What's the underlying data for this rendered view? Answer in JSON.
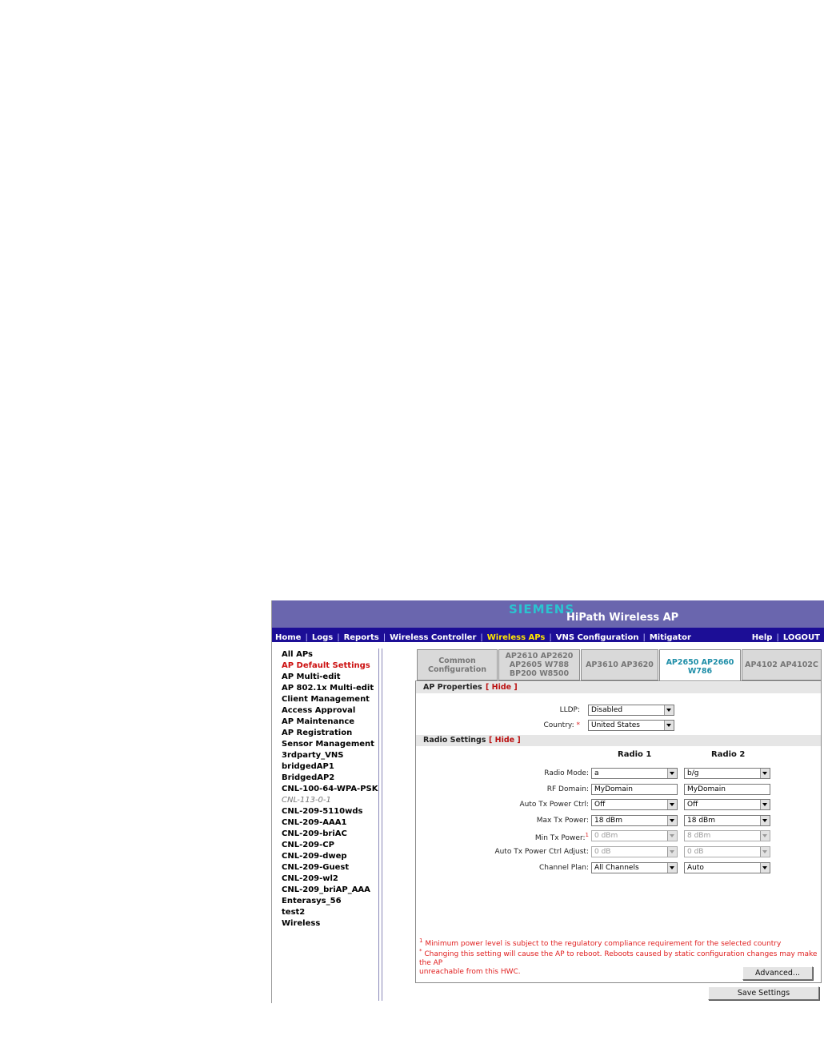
{
  "header": {
    "brand": "SIEMENS",
    "product": "HiPath Wireless AP"
  },
  "nav": {
    "left": [
      "Home",
      "Logs",
      "Reports",
      "Wireless Controller",
      "Wireless APs",
      "VNS Configuration",
      "Mitigator"
    ],
    "active": "Wireless APs",
    "right": [
      "Help",
      "LOGOUT"
    ]
  },
  "sidebar": {
    "items": [
      "All APs",
      "AP Default Settings",
      "AP Multi-edit",
      "AP 802.1x Multi-edit",
      "Client Management",
      "Access Approval",
      "AP Maintenance",
      "AP Registration",
      "Sensor Management",
      "3rdparty_VNS",
      "bridgedAP1",
      "BridgedAP2",
      "CNL-100-64-WPA-PSK",
      "CNL-113-0-1",
      "CNL-209-5110wds",
      "CNL-209-AAA1",
      "CNL-209-briAC",
      "CNL-209-CP",
      "CNL-209-dwep",
      "CNL-209-Guest",
      "CNL-209-wl2",
      "CNL-209_briAP_AAA",
      "Enterasys_56",
      "test2",
      "Wireless"
    ],
    "selected": "AP Default Settings"
  },
  "tabs": [
    {
      "label": "Common\nConfiguration"
    },
    {
      "label": "AP2610 AP2620\nAP2605 W788\nBP200 W8500"
    },
    {
      "label": "AP3610 AP3620"
    },
    {
      "label": "AP2650 AP2660\nW786"
    },
    {
      "label": "AP4102 AP4102C"
    }
  ],
  "active_tab": "AP2650 AP2660 W786",
  "ap_properties": {
    "title": "AP Properties",
    "hide": "[ Hide ]",
    "lldp_label": "LLDP:",
    "lldp_value": "Disabled",
    "country_label": "Country:",
    "country_required": "*",
    "country_value": "United States"
  },
  "radio_settings": {
    "title": "Radio Settings",
    "hide": "[ Hide ]",
    "col1": "Radio 1",
    "col2": "Radio 2",
    "rows": [
      {
        "label": "Radio Mode:",
        "r1": "a",
        "r2": "b/g"
      },
      {
        "label": "RF Domain:",
        "r1": "MyDomain",
        "r2": "MyDomain"
      },
      {
        "label": "Auto Tx Power Ctrl:",
        "r1": "Off",
        "r2": "Off"
      },
      {
        "label": "Max Tx Power:",
        "r1": "18 dBm",
        "r2": "18 dBm"
      },
      {
        "label": "Min Tx Power:",
        "sup": "1",
        "r1": "0 dBm",
        "r2": "8 dBm"
      },
      {
        "label": "Auto Tx Power Ctrl Adjust:",
        "r1": "0 dB",
        "r2": "0 dB"
      },
      {
        "label": "Channel Plan:",
        "r1": "All Channels",
        "r2": "Auto"
      }
    ]
  },
  "notes": {
    "note1_mark": "1",
    "note1": "Minimum power level is subject to the regulatory compliance requirement for the selected country",
    "note2_mark": "*",
    "note2a": "Changing this setting will cause the AP to reboot. Reboots caused by static configuration changes may make the AP",
    "note2b": "unreachable from this HWC."
  },
  "buttons": {
    "advanced": "Advanced...",
    "save": "Save Settings"
  }
}
